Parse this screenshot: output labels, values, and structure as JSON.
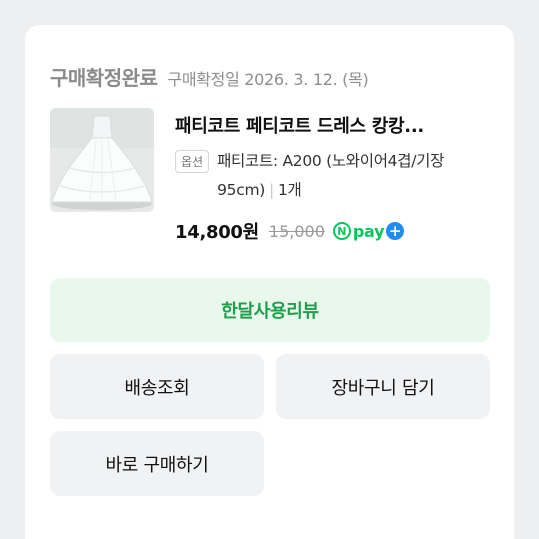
{
  "order": {
    "status": "구매확정완료",
    "confirm_date": "구매확정일 2026. 3. 12. (목)"
  },
  "product": {
    "name": "패티코트 페티코트 드레스 캉캉...",
    "option_badge": "옵션",
    "option_value": "패티코트: A200 (노와이어4겹/기장95cm)",
    "quantity": "1개",
    "price": "14,800원",
    "original_price": "15,000",
    "npay_n": "N",
    "npay_word": "pay",
    "npay_plus": "+"
  },
  "buttons": {
    "review": "한달사용리뷰",
    "track": "배송조회",
    "cart": "장바구니 담기",
    "buy_again": "바로 구매하기"
  },
  "colors": {
    "review_bg": "#e8f8ec",
    "review_text": "#1f9e4c",
    "npay_green": "#03c75a",
    "npay_blue": "#1e8cf0"
  }
}
